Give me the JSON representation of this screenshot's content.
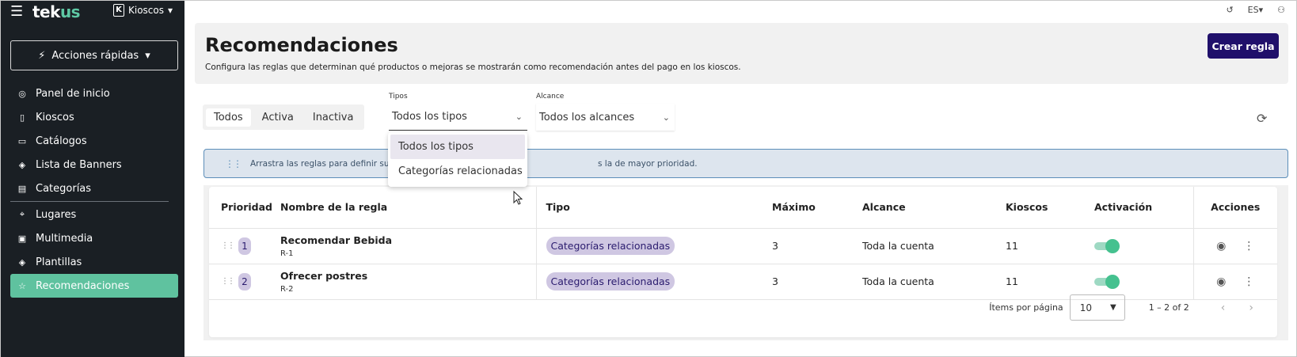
{
  "app": {
    "logo_a": "tek",
    "logo_b": "us",
    "store_badge": "K",
    "store_label": "Kioscos",
    "store_caret": "▾"
  },
  "sidebar": {
    "quick_actions": "Acciones rápidas",
    "items": [
      {
        "label": "Panel de inicio",
        "icon": "dashboard-icon"
      },
      {
        "label": "Kioscos",
        "icon": "kiosk-icon"
      },
      {
        "label": "Catálogos",
        "icon": "book-icon"
      },
      {
        "label": "Lista de Banners",
        "icon": "layers-icon"
      },
      {
        "label": "Categorías",
        "icon": "categories-icon"
      },
      {
        "label": "Lugares",
        "icon": "pin-icon"
      },
      {
        "label": "Multimedia",
        "icon": "image-icon"
      },
      {
        "label": "Plantillas",
        "icon": "stack-icon"
      },
      {
        "label": "Recomendaciones",
        "icon": "star-icon"
      }
    ],
    "active": "Recomendaciones"
  },
  "topbar": {
    "lang": "ES"
  },
  "header": {
    "title": "Recomendaciones",
    "description": "Configura las reglas que determinan qué productos o mejoras se mostrarán como recomendación antes del pago en los kioscos.",
    "create_button": "Crear regla"
  },
  "filters": {
    "tabs": [
      "Todos",
      "Activa",
      "Inactiva"
    ],
    "active_tab": "Todos",
    "tipos_label": "Tipos",
    "tipos_value": "Todos los tipos",
    "alcance_label": "Alcance",
    "alcance_value": "Todos los alcances",
    "tipos_options": [
      "Todos los tipos",
      "Categorías relacionadas"
    ]
  },
  "banner": {
    "text_left": "Arrastra las reglas para definir su",
    "text_right": "s la de mayor prioridad."
  },
  "table": {
    "headers": {
      "prioridad": "Prioridad",
      "nombre": "Nombre de la regla",
      "tipo": "Tipo",
      "maximo": "Máximo",
      "alcance": "Alcance",
      "kioscos": "Kioscos",
      "activacion": "Activación",
      "acciones": "Acciones"
    },
    "rows": [
      {
        "priority": "1",
        "name": "Recomendar Bebida",
        "code": "R-1",
        "tipo": "Categorías relacionadas",
        "maximo": "3",
        "alcance": "Toda la cuenta",
        "kioscos": "11",
        "active": true
      },
      {
        "priority": "2",
        "name": "Ofrecer postres",
        "code": "R-2",
        "tipo": "Categorías relacionadas",
        "maximo": "3",
        "alcance": "Toda la cuenta",
        "kioscos": "11",
        "active": true
      }
    ]
  },
  "pagination": {
    "per_page_label": "Ítems por página",
    "per_page_value": "10",
    "range": "1 – 2 of 2"
  },
  "colors": {
    "sidebar_bg": "#1a1f24",
    "accent": "#5fc29f",
    "primary": "#20106b",
    "chip": "#cfc7e2",
    "banner_border": "#5c8eb9"
  }
}
